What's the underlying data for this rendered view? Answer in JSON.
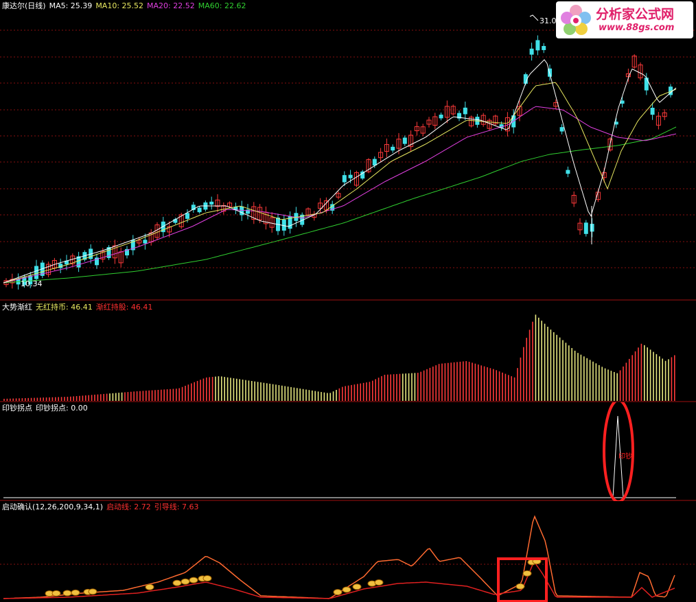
{
  "main_panel": {
    "header": [
      {
        "text": "康达尔(日线)",
        "color": "#ffffff"
      },
      {
        "text": "MA5: 25.39",
        "color": "#ffffff"
      },
      {
        "text": "MA10: 25.52",
        "color": "#e8e860"
      },
      {
        "text": "MA20: 22.52",
        "color": "#e040e0"
      },
      {
        "text": "MA60: 22.62",
        "color": "#30d030"
      }
    ],
    "high_label": "31.04",
    "low_label": "10.34"
  },
  "logo": {
    "title": "分析家公式网",
    "url": "www.88gs.com"
  },
  "panel2": {
    "header": [
      {
        "text": "大势渐红",
        "color": "#ffffff"
      },
      {
        "text": "无红持币: 46.41",
        "color": "#e8e860"
      },
      {
        "text": "渐红持股: 46.41",
        "color": "#ff3030"
      }
    ]
  },
  "panel3": {
    "header": [
      {
        "text": "印钞拐点",
        "color": "#ffffff"
      },
      {
        "text": "印钞拐点: 0.00",
        "color": "#ffffff"
      }
    ],
    "spike_label": "印钞"
  },
  "panel4": {
    "header": [
      {
        "text": "启动确认(12,26,200,9,34,1)",
        "color": "#ffffff"
      },
      {
        "text": "启动线: 2.72",
        "color": "#ff3030"
      },
      {
        "text": "引导线: 7.63",
        "color": "#ff3030"
      }
    ]
  },
  "colors": {
    "up": "#ff3a3a",
    "down": "#40e0e8",
    "ma5": "#ffffff",
    "ma10": "#e8e860",
    "ma20": "#e040e0",
    "ma60": "#30d030",
    "divider": "#a01010",
    "annotation": "#ff2020"
  },
  "chart_data": [
    {
      "type": "candlestick",
      "series": [
        {
          "name": "MA5",
          "last": 25.39
        },
        {
          "name": "MA10",
          "last": 25.52
        },
        {
          "name": "MA20",
          "last": 22.52
        },
        {
          "name": "MA60",
          "last": 22.62
        }
      ],
      "high": 31.04,
      "low": 10.34
    },
    {
      "type": "bar",
      "series": [
        {
          "name": "无红持币",
          "last": 46.41
        },
        {
          "name": "渐红持股",
          "last": 46.41
        }
      ]
    },
    {
      "type": "line",
      "series": [
        {
          "name": "印钞拐点",
          "last": 0.0
        }
      ]
    },
    {
      "type": "line",
      "series": [
        {
          "name": "启动线",
          "last": 2.72
        },
        {
          "name": "引导线",
          "last": 7.63
        }
      ]
    }
  ]
}
